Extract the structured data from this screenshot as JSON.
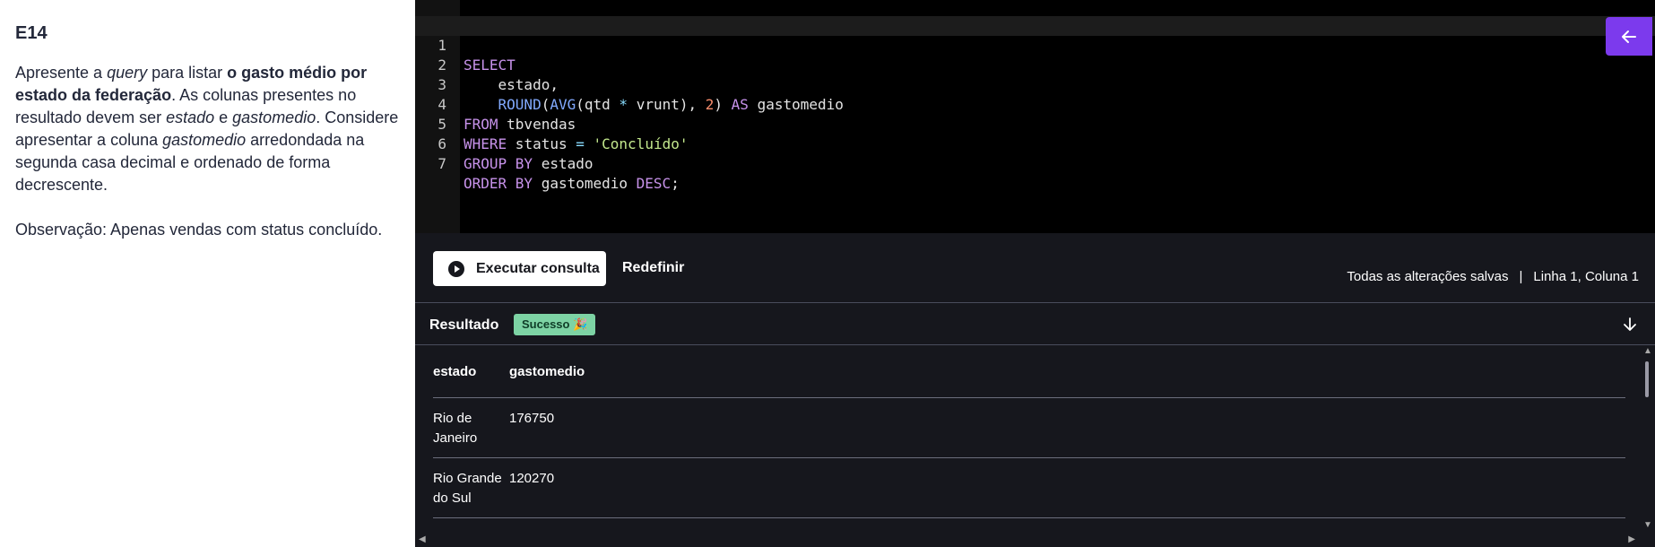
{
  "exercise": {
    "id": "E14",
    "p1_a": "Apresente a ",
    "p1_query": "query",
    "p1_b": " para listar ",
    "p1_bold": "o gasto médio por estado da federação",
    "p1_c": ". As colunas presentes no resultado devem ser ",
    "p1_estado": "estado",
    "p1_d": " e ",
    "p1_gasto": "gastomedio",
    "p1_e": ". Considere apresentar a coluna ",
    "p1_gasto2": "gastomedio",
    "p1_f": " arredondada na segunda casa decimal e ordenado de forma decrescente.",
    "observation": "Observação: Apenas vendas com status concluído."
  },
  "editor": {
    "line_numbers": [
      "1",
      "2",
      "3",
      "4",
      "5",
      "6",
      "7"
    ],
    "l1_kw": "SELECT",
    "l2_text": "    estado,",
    "l3_indent": "    ",
    "l3_fn1": "ROUND",
    "l3_p1": "(",
    "l3_fn2": "AVG",
    "l3_expr": "(qtd ",
    "l3_op": "*",
    "l3_expr2": " vrunt), ",
    "l3_num": "2",
    "l3_p2": ") ",
    "l3_kw": "AS",
    "l3_alias": " gastomedio",
    "l4_kw": "FROM",
    "l4_text": " tbvendas",
    "l5_kw": "WHERE",
    "l5_text": " status ",
    "l5_op": "=",
    "l5_sp": " ",
    "l5_str": "'Concluído'",
    "l6_kw": "GROUP BY",
    "l6_text": " estado",
    "l7_kw": "ORDER BY",
    "l7_text": " gastomedio ",
    "l7_kw2": "DESC",
    "l7_end": ";"
  },
  "toolbar": {
    "run_label": "Executar consulta",
    "reset_label": "Redefinir",
    "saved_status": "Todas as alterações salvas",
    "separator": "|",
    "cursor_position": "Linha 1, Coluna 1"
  },
  "result": {
    "title": "Resultado",
    "badge": "Sucesso 🎉",
    "columns": [
      "estado",
      "gastomedio"
    ],
    "rows": [
      [
        "Rio de Janeiro",
        "176750"
      ],
      [
        "Rio Grande do Sul",
        "120270"
      ]
    ]
  },
  "colors": {
    "accent": "#7c3aed",
    "success_badge": "#7dd3a4"
  },
  "icons": {
    "back": "arrow-left-icon",
    "run": "play-circle-icon",
    "collapse": "arrow-down-icon"
  }
}
